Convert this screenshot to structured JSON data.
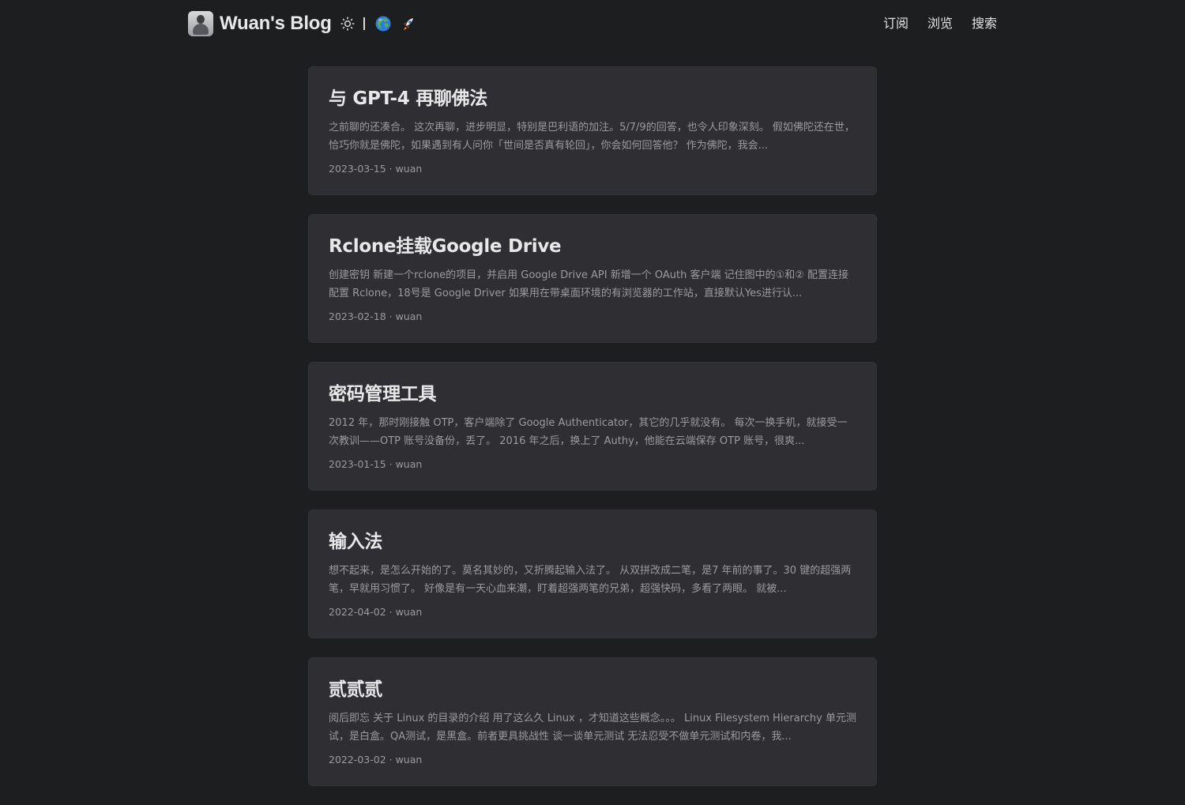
{
  "header": {
    "site_title": "Wuan's Blog",
    "theme_toggle_icon": "sun-icon",
    "language_icons": [
      "globe-icon",
      "rocket-icon"
    ],
    "nav": [
      {
        "label": "订阅"
      },
      {
        "label": "浏览"
      },
      {
        "label": "搜索"
      }
    ]
  },
  "posts": [
    {
      "title": "与 GPT-4 再聊佛法",
      "summary": "之前聊的还凑合。 这次再聊，进步明显，特别是巴利语的加注。5/7/9的回答，也令人印象深刻。 假如佛陀还在世，恰巧你就是佛陀，如果遇到有人问你「世间是否真有轮回」，你会如何回答他？ 作为佛陀，我会...",
      "meta": "2023-03-15 · wuan"
    },
    {
      "title": "Rclone挂载Google Drive",
      "summary": "创建密钥 新建一个rclone的项目，并启用 Google Drive API 新增一个 OAuth 客户端 记住图中的①和② 配置连接 配置 Rclone，18号是 Google Driver 如果用在带桌面环境的有浏览器的工作站，直接默认Yes进行认...",
      "meta": "2023-02-18 · wuan"
    },
    {
      "title": "密码管理工具",
      "summary": "2012 年，那时刚接触 OTP，客户端除了 Google Authenticator，其它的几乎就没有。 每次一换手机，就接受一次教训——OTP 账号没备份，丢了。 2016 年之后，换上了 Authy，他能在云端保存 OTP 账号，很爽...",
      "meta": "2023-01-15 · wuan"
    },
    {
      "title": "输入法",
      "summary": "想不起来，是怎么开始的了。莫名其妙的，又折腾起输入法了。 从双拼改成二笔，是7 年前的事了。30 键的超强两笔，早就用习惯了。 好像是有一天心血来潮，盯着超强两笔的兄弟，超强快码，多看了两眼。 就被...",
      "meta": "2022-04-02 · wuan"
    },
    {
      "title": "贰贰贰",
      "summary": "阅后即忘 关于 Linux 的目录的介绍 用了这么久 Linux ，才知道这些概念。。。 Linux Filesystem Hierarchy 单元测试，是白盒。QA测试，是黑盒。前者更具挑战性 谈一谈单元测试 无法忍受不做单元测试和内卷，我...",
      "meta": "2022-03-02 · wuan"
    }
  ]
}
